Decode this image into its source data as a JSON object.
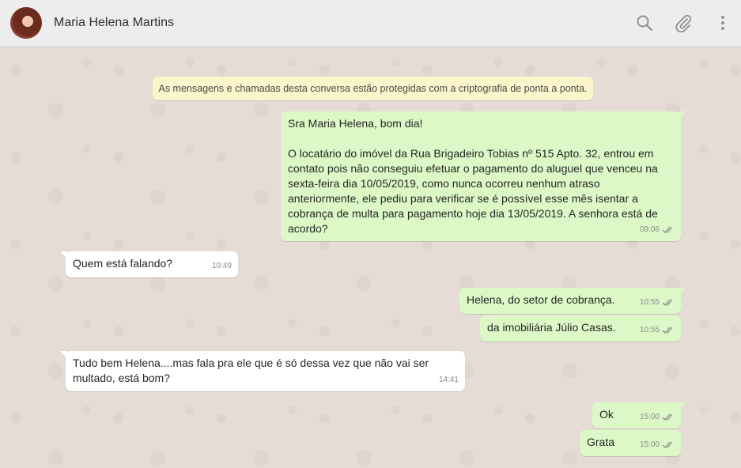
{
  "header": {
    "contact_name": "Maria Helena Martins",
    "icons": [
      "search-icon",
      "attach-icon",
      "menu-icon"
    ]
  },
  "chat": {
    "encryption_notice": "As mensagens e chamadas desta conversa estão protegidas com a criptografia de ponta a ponta.",
    "messages": [
      {
        "direction": "outgoing",
        "text": "Sra Maria Helena, bom dia!\n\nO locatário do imóvel da Rua Brigadeiro Tobias nº 515 Apto. 32, entrou em\ncontato pois não conseguiu efetuar o pagamento do aluguel que venceu na\nsexta-feira dia 10/05/2019, como nunca ocorreu nenhum atraso\nanteriormente, ele pediu para verificar se é possível esse mês isentar a\ncobrança de multa para pagamento hoje dia 13/05/2019. A senhora está de\nacordo?",
        "time": "09:06",
        "status": "read"
      },
      {
        "direction": "incoming",
        "text": "Quem está falando?",
        "time": "10:49"
      },
      {
        "direction": "outgoing",
        "text": "Helena, do setor de cobrança.",
        "time": "10:55",
        "status": "read"
      },
      {
        "direction": "outgoing",
        "text": "da imobiliária Júlio Casas.",
        "time": "10:55",
        "status": "read"
      },
      {
        "direction": "incoming",
        "text": "Tudo bem Helena....mas fala pra ele que é só dessa vez que não vai ser\nmultado, está bom?",
        "time": "14:41"
      },
      {
        "direction": "outgoing",
        "text": "Ok",
        "time": "15:00",
        "status": "read"
      },
      {
        "direction": "outgoing",
        "text": "Grata",
        "time": "15:00",
        "status": "read"
      }
    ]
  },
  "colors": {
    "header_bg": "#ededed",
    "chat_bg": "#e5ddd5",
    "outgoing_bubble": "#dcf8c6",
    "incoming_bubble": "#ffffff",
    "notice_bg": "#fcf4cb",
    "icon_gray": "#919191"
  }
}
